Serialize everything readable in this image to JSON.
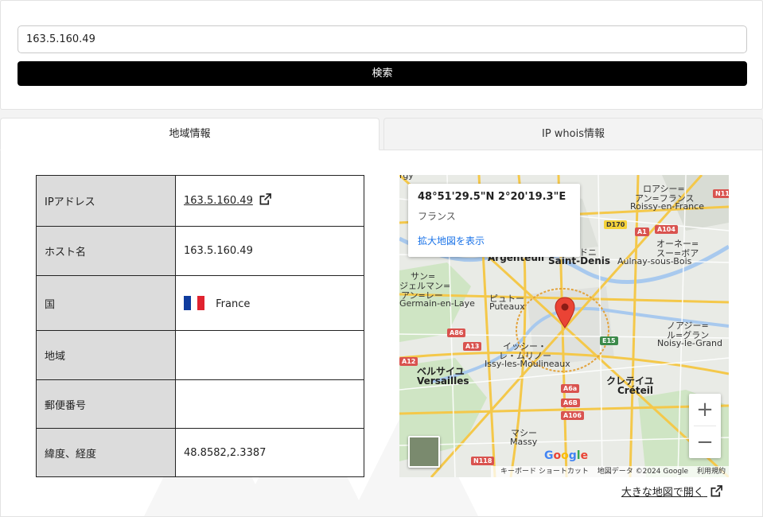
{
  "search": {
    "ip_value": "163.5.160.49",
    "button_label": "検索"
  },
  "tabs": [
    {
      "label": "地域情報",
      "active": true
    },
    {
      "label": "IP whois情報",
      "active": false
    }
  ],
  "info_table": {
    "rows": [
      {
        "label": "IPアドレス",
        "value": "163.5.160.49"
      },
      {
        "label": "ホスト名",
        "value": "163.5.160.49"
      },
      {
        "label": "国",
        "value": "France"
      },
      {
        "label": "地域",
        "value": ""
      },
      {
        "label": "郵便番号",
        "value": ""
      },
      {
        "label": "緯度、経度",
        "value": "48.8582,2.3387"
      }
    ],
    "flag_colors": [
      "#0f3c9e",
      "#ffffff",
      "#e0232f"
    ]
  },
  "map": {
    "info_window": {
      "coords": "48°51'29.5\"N 2°20'19.3\"E",
      "country": "フランス",
      "link_label": "拡大地図を表示"
    },
    "labels": {
      "roissy_jp1": "ロアシー=",
      "roissy_jp2": "アン=フランス",
      "roissy_fr": "Roissy-en-France",
      "aulnay_jp1": "オーネー=",
      "aulnay_jp2": "スー=ボア",
      "aulnay_fr": "Aulnay-sous-Bois",
      "saint_denis_fr": "Saint-Denis",
      "saint_denis_jp": "ドニ",
      "argenteuil_fr": "Argenteuil",
      "germain_jp1": "サン=",
      "germain_jp2": "ジェルマン=",
      "germain_jp3": "アン=レー",
      "germain_fr": "Germain-en-Laye",
      "puteaux_jp": "ピュトー",
      "puteaux_fr": "Puteaux",
      "noisy_jp1": "ノアジー=",
      "noisy_jp2": "ル=グラン",
      "noisy_fr": "Noisy-le-Grand",
      "issy_jp1": "イッシー・",
      "issy_jp2": "レ・ムリノー",
      "issy_fr": "Issy-les-Moulineaux",
      "versailles_jp": "ベルサイユ",
      "versailles_fr": "Versailles",
      "creteil_jp": "クレテイユ",
      "creteil_fr": "Créteil",
      "massy_jp": "マシー",
      "massy_fr": "Massy",
      "gy": "rgy"
    },
    "roads": {
      "n11": "N11",
      "d170": "D170",
      "a1": "A1",
      "a104": "A104",
      "a86": "A86",
      "a13": "A13",
      "a12": "A12",
      "e15": "E15",
      "a6a": "A6a",
      "a6b": "A6B",
      "a106": "A106",
      "n118": "N118"
    },
    "google_logo": "Google",
    "shortcuts": "キーボード ショートカット",
    "map_data": "地図データ ©2024 Google",
    "terms": "利用規約",
    "zoom_in": "+",
    "zoom_out": "−"
  },
  "open_map_label": "大きな地図で開く"
}
